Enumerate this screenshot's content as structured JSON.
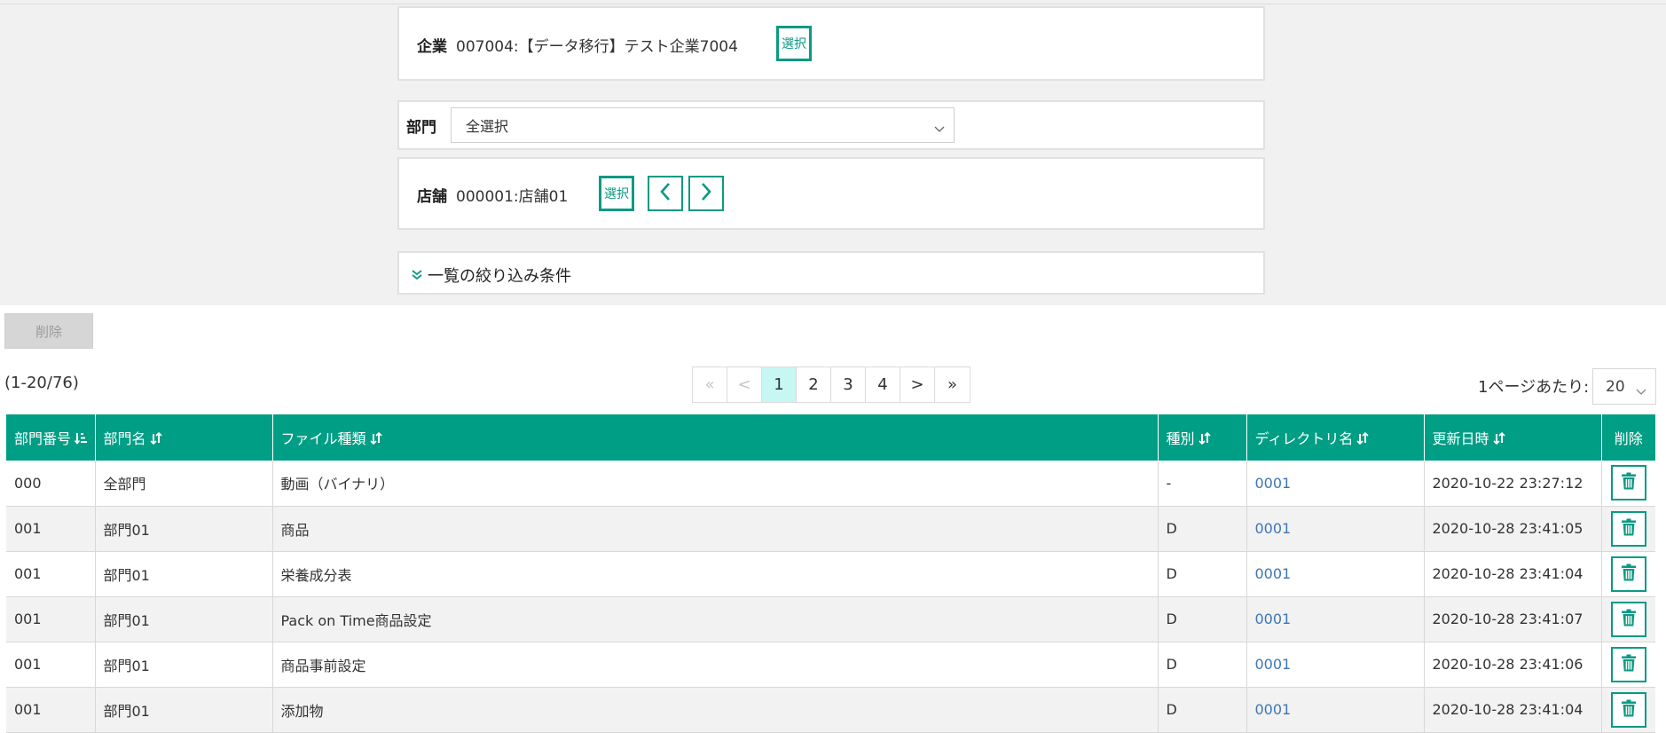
{
  "company": {
    "label": "企業",
    "value": "007004:【データ移行】テスト企業7004",
    "select_label": "選択"
  },
  "department": {
    "label": "部門",
    "selected": "全選択"
  },
  "store": {
    "label": "店舗",
    "value": "000001:店舗01",
    "select_label": "選択"
  },
  "filter": {
    "toggle_label": "一覧の絞り込み条件"
  },
  "actions": {
    "delete_label": "削除"
  },
  "result_count": "(1-20/76)",
  "pagination": {
    "first": "«",
    "prev": "<",
    "pages": [
      "1",
      "2",
      "3",
      "4"
    ],
    "current": "1",
    "next": ">",
    "last": "»"
  },
  "per_page": {
    "label": "1ページあたり:",
    "value": "20"
  },
  "table": {
    "columns": [
      "部門番号",
      "部門名",
      "ファイル種類",
      "種別",
      "ディレクトリ名",
      "更新日時",
      "削除"
    ],
    "rows": [
      {
        "dept_no": "000",
        "dept_name": "全部門",
        "file_type": "動画（バイナリ）",
        "kind": "-",
        "directory": "0001",
        "updated": "2020-10-22 23:27:12"
      },
      {
        "dept_no": "001",
        "dept_name": "部門01",
        "file_type": "商品",
        "kind": "D",
        "directory": "0001",
        "updated": "2020-10-28 23:41:05"
      },
      {
        "dept_no": "001",
        "dept_name": "部門01",
        "file_type": "栄養成分表",
        "kind": "D",
        "directory": "0001",
        "updated": "2020-10-28 23:41:04"
      },
      {
        "dept_no": "001",
        "dept_name": "部門01",
        "file_type": "Pack on Time商品設定",
        "kind": "D",
        "directory": "0001",
        "updated": "2020-10-28 23:41:07"
      },
      {
        "dept_no": "001",
        "dept_name": "部門01",
        "file_type": "商品事前設定",
        "kind": "D",
        "directory": "0001",
        "updated": "2020-10-28 23:41:06"
      },
      {
        "dept_no": "001",
        "dept_name": "部門01",
        "file_type": "添加物",
        "kind": "D",
        "directory": "0001",
        "updated": "2020-10-28 23:41:04"
      }
    ]
  },
  "colors": {
    "accent": "#009e85",
    "link": "#3d77b6",
    "active_page": "#c7f7f3"
  }
}
